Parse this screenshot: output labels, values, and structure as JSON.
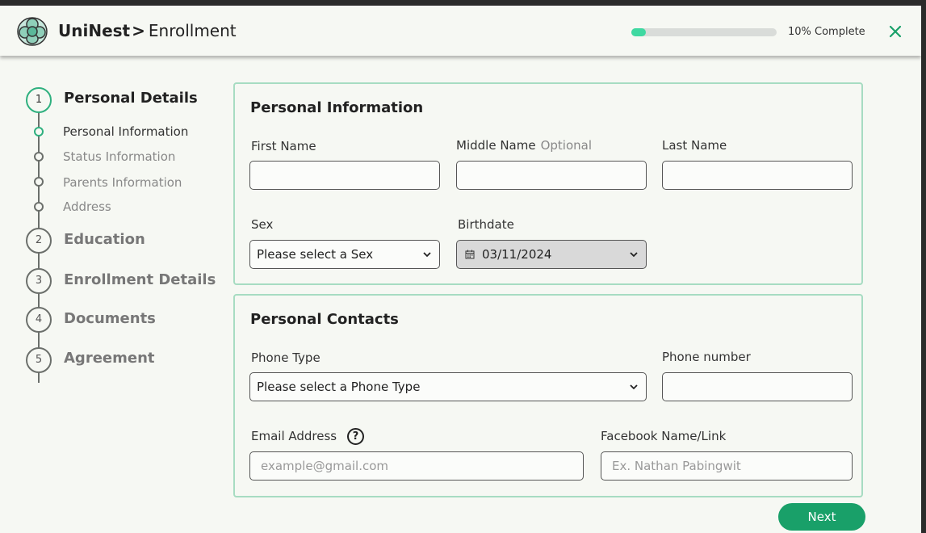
{
  "header": {
    "brand": "UniNest",
    "separator": ">",
    "page": "Enrollment",
    "progress_percent": 10,
    "progress_text": "10% Complete",
    "accent_color": "#3fd9a1"
  },
  "stepper": {
    "steps": [
      {
        "number": "1",
        "title": "Personal Details"
      },
      {
        "number": "2",
        "title": "Education"
      },
      {
        "number": "3",
        "title": "Enrollment Details"
      },
      {
        "number": "4",
        "title": "Documents"
      },
      {
        "number": "5",
        "title": "Agreement"
      }
    ],
    "substeps": [
      "Personal Information",
      "Status Information",
      "Parents Information",
      "Address"
    ]
  },
  "personal_information": {
    "title": "Personal Information",
    "first_name_label": "First Name",
    "middle_name_label": "Middle Name",
    "middle_name_optional": "Optional",
    "last_name_label": "Last Name",
    "sex_label": "Sex",
    "sex_value": "Please select a Sex",
    "birthdate_label": "Birthdate",
    "birthdate_value": "03/11/2024"
  },
  "personal_contacts": {
    "title": "Personal Contacts",
    "phone_type_label": "Phone Type",
    "phone_type_value": "Please select a Phone Type",
    "phone_number_label": "Phone number",
    "email_label": "Email Address",
    "email_placeholder": "example@gmail.com",
    "help_symbol": "?",
    "facebook_label": "Facebook Name/Link",
    "facebook_placeholder": "Ex. Nathan Pabingwit"
  },
  "footer": {
    "next_label": "Next",
    "next_color": "#19a069"
  }
}
